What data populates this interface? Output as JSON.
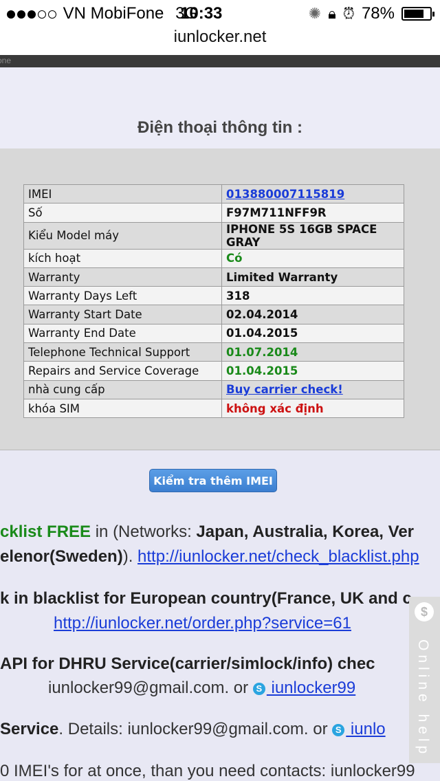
{
  "status_bar": {
    "signal_dots": [
      true,
      true,
      true,
      false,
      false
    ],
    "carrier": "VN MobiFone",
    "network": "3G",
    "time": "10:33",
    "battery_text": "78%",
    "battery_level": 0.78
  },
  "url_bar": {
    "domain": "iunlocker.net"
  },
  "top_strip_text": "one",
  "page": {
    "heading": "Điện thoại thông tin :"
  },
  "info_table": [
    {
      "key": "IMEI",
      "value": "013880007115819",
      "style": "link"
    },
    {
      "key": "Số",
      "value": "F97M711NFF9R",
      "style": "plain"
    },
    {
      "key": "Kiểu Model máy",
      "value": "IPHONE 5S 16GB SPACE GRAY",
      "style": "plain"
    },
    {
      "key": "kích hoạt",
      "value": "Có",
      "style": "green"
    },
    {
      "key": "Warranty",
      "value": "Limited Warranty",
      "style": "plain"
    },
    {
      "key": "Warranty Days Left",
      "value": "318",
      "style": "plain"
    },
    {
      "key": "Warranty Start Date",
      "value": "02.04.2014",
      "style": "plain"
    },
    {
      "key": "Warranty End Date",
      "value": "01.04.2015",
      "style": "plain"
    },
    {
      "key": "Telephone Technical Support",
      "value": "01.07.2014",
      "style": "green"
    },
    {
      "key": "Repairs and Service Coverage",
      "value": "01.04.2015",
      "style": "green"
    },
    {
      "key": "nhà cung cấp",
      "value": "Buy carrier check!",
      "style": "link"
    },
    {
      "key": "khóa SIM",
      "value": "không xác định",
      "style": "red"
    }
  ],
  "check_more_button": "Kiểm tra thêm IMEI",
  "promo": {
    "l1_green": "cklist FREE",
    "l1_text": " in (Networks: ",
    "l1_bold": "Japan, Australia, Korea, Ver",
    "l2_bold": "elenor(Sweden)",
    "l2_text": "). ",
    "l2_link": "http://iunlocker.net/check_blacklist.php",
    "l3_bold": "k in blacklist for European country(France, UK and c",
    "l4_link": "http://iunlocker.net/order.php?service=61",
    "l5_bold": " API for DHRU Service(carrier/simlock/info) chec",
    "l6_text": "iunlocker99@gmail.com. or ",
    "l6_link": " iunlocker99",
    "l7_bold": "Service",
    "l7_text": ". Details: iunlocker99@gmail.com. or ",
    "l7_link": " iunlo",
    "l8_text": "0 IMEI's for at once, than you need contacts: iunlocker99"
  },
  "online_help": {
    "label": "Online help"
  },
  "colors": {
    "link": "#1a3cd8",
    "green": "#1a8a1a",
    "red": "#cc1111",
    "button": "#3c7fd0"
  }
}
